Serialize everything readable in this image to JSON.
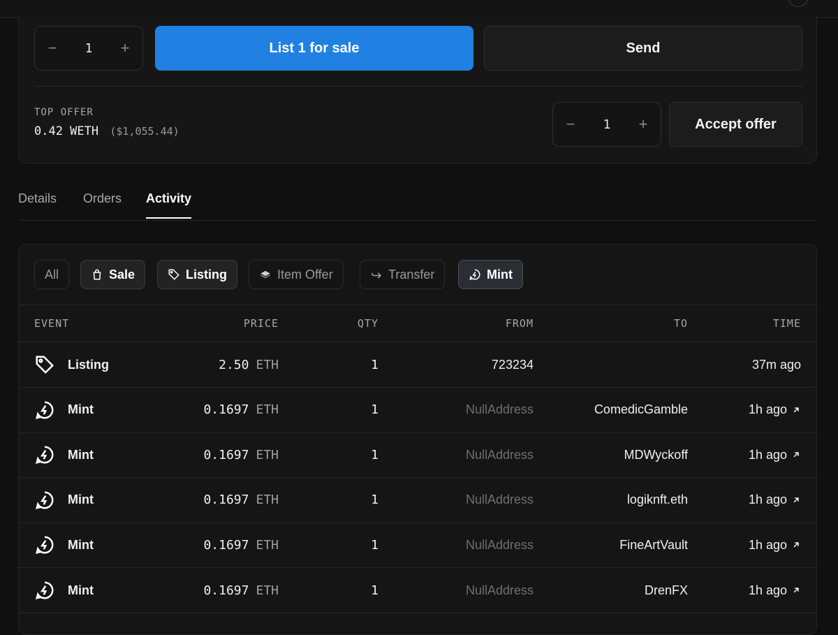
{
  "listing": {
    "quantity": "1",
    "list_button": "List 1 for sale",
    "send_button": "Send"
  },
  "offer": {
    "label": "TOP OFFER",
    "amount": "0.42 WETH",
    "usd": "($1,055.44)",
    "quantity": "1",
    "accept_button": "Accept offer"
  },
  "tabs": [
    {
      "label": "Details",
      "active": false
    },
    {
      "label": "Orders",
      "active": false
    },
    {
      "label": "Activity",
      "active": true
    }
  ],
  "filters": [
    {
      "label": "All",
      "icon": "none",
      "active": false
    },
    {
      "label": "Sale",
      "icon": "shopping-bag-icon",
      "active": true
    },
    {
      "label": "Listing",
      "icon": "tag-icon",
      "active": true
    },
    {
      "label": "Item Offer",
      "icon": "layers-icon",
      "active": false
    },
    {
      "label": "Transfer",
      "icon": "transfer-arrow-icon",
      "active": false
    },
    {
      "label": "Mint",
      "icon": "mint-icon",
      "active": true
    }
  ],
  "table": {
    "columns": [
      "EVENT",
      "PRICE",
      "QTY",
      "FROM",
      "TO",
      "TIME"
    ],
    "rows": [
      {
        "event": "Listing",
        "icon": "tag-icon",
        "price": "2.50",
        "unit": "ETH",
        "qty": "1",
        "from": "723234",
        "to": "",
        "time": "37m ago",
        "link": false
      },
      {
        "event": "Mint",
        "icon": "mint-icon",
        "price": "0.1697",
        "unit": "ETH",
        "qty": "1",
        "from": "NullAddress",
        "to": "ComedicGamble",
        "time": "1h ago",
        "link": true
      },
      {
        "event": "Mint",
        "icon": "mint-icon",
        "price": "0.1697",
        "unit": "ETH",
        "qty": "1",
        "from": "NullAddress",
        "to": "MDWyckoff",
        "time": "1h ago",
        "link": true
      },
      {
        "event": "Mint",
        "icon": "mint-icon",
        "price": "0.1697",
        "unit": "ETH",
        "qty": "1",
        "from": "NullAddress",
        "to": "logiknft.eth",
        "time": "1h ago",
        "link": true
      },
      {
        "event": "Mint",
        "icon": "mint-icon",
        "price": "0.1697",
        "unit": "ETH",
        "qty": "1",
        "from": "NullAddress",
        "to": "FineArtVault",
        "time": "1h ago",
        "link": true
      },
      {
        "event": "Mint",
        "icon": "mint-icon",
        "price": "0.1697",
        "unit": "ETH",
        "qty": "1",
        "from": "NullAddress",
        "to": "DrenFX",
        "time": "1h ago",
        "link": true
      }
    ]
  },
  "colors": {
    "accent": "#2081e2",
    "background": "#101010",
    "card": "#161616",
    "muted_text": "#a8a8a8"
  }
}
